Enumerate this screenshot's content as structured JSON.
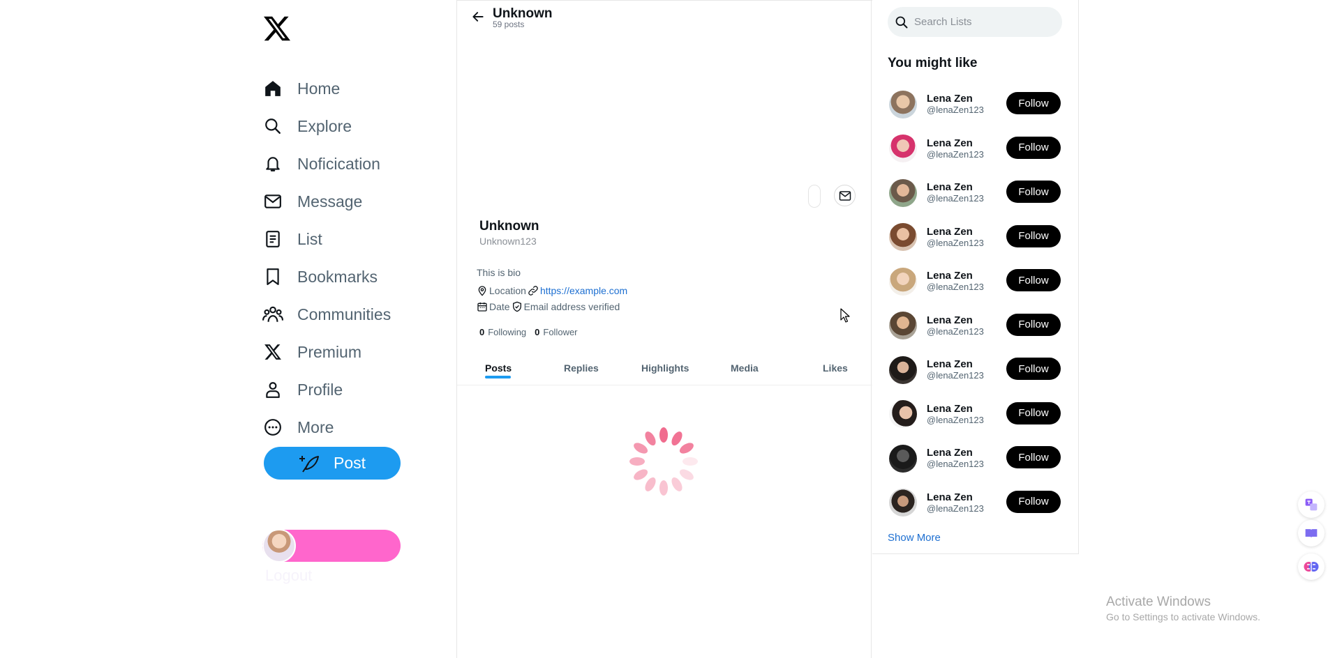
{
  "sidebar": {
    "logo_icon": "x-logo-icon",
    "items": [
      {
        "label": "Home",
        "icon": "home-icon"
      },
      {
        "label": "Explore",
        "icon": "search-icon"
      },
      {
        "label": "Noficication",
        "icon": "bell-icon"
      },
      {
        "label": "Message",
        "icon": "envelope-icon"
      },
      {
        "label": "List",
        "icon": "list-icon"
      },
      {
        "label": "Bookmarks",
        "icon": "bookmark-icon"
      },
      {
        "label": "Communities",
        "icon": "people-icon"
      },
      {
        "label": "Premium",
        "icon": "x-logo-icon"
      },
      {
        "label": "Profile",
        "icon": "person-icon"
      },
      {
        "label": "More",
        "icon": "more-circle-icon"
      }
    ],
    "post_label": "Post",
    "logout_label": "Logout",
    "colors": {
      "post": "#1d9bf0",
      "user_pill": "#ff66cc"
    }
  },
  "header": {
    "title": "Unknown",
    "posts_count": "59 posts"
  },
  "profile": {
    "name": "Unknown",
    "handle": "Unknown123",
    "bio": "This is bio",
    "location": "Location",
    "website": "https://example.com",
    "date": "Date",
    "verified": "Email address verified",
    "following_count": "0",
    "following_label": "Following",
    "follower_count": "0",
    "follower_label": "Follower"
  },
  "tabs": [
    {
      "label": "Posts",
      "active": true
    },
    {
      "label": "Replies",
      "active": false
    },
    {
      "label": "Highlights",
      "active": false
    },
    {
      "label": "Media",
      "active": false
    },
    {
      "label": "Likes",
      "active": false
    }
  ],
  "right": {
    "search_placeholder": "Search Lists",
    "heading": "You might like",
    "follow_label": "Follow",
    "show_more": "Show More",
    "suggestions": [
      {
        "name": "Lena Zen",
        "handle": "@lenaZen123"
      },
      {
        "name": "Lena Zen",
        "handle": "@lenaZen123"
      },
      {
        "name": "Lena Zen",
        "handle": "@lenaZen123"
      },
      {
        "name": "Lena Zen",
        "handle": "@lenaZen123"
      },
      {
        "name": "Lena Zen",
        "handle": "@lenaZen123"
      },
      {
        "name": "Lena Zen",
        "handle": "@lenaZen123"
      },
      {
        "name": "Lena Zen",
        "handle": "@lenaZen123"
      },
      {
        "name": "Lena Zen",
        "handle": "@lenaZen123"
      },
      {
        "name": "Lena Zen",
        "handle": "@lenaZen123"
      },
      {
        "name": "Lena Zen",
        "handle": "@lenaZen123"
      }
    ]
  },
  "watermark": {
    "title": "Activate Windows",
    "subtitle": "Go to Settings to activate Windows."
  }
}
